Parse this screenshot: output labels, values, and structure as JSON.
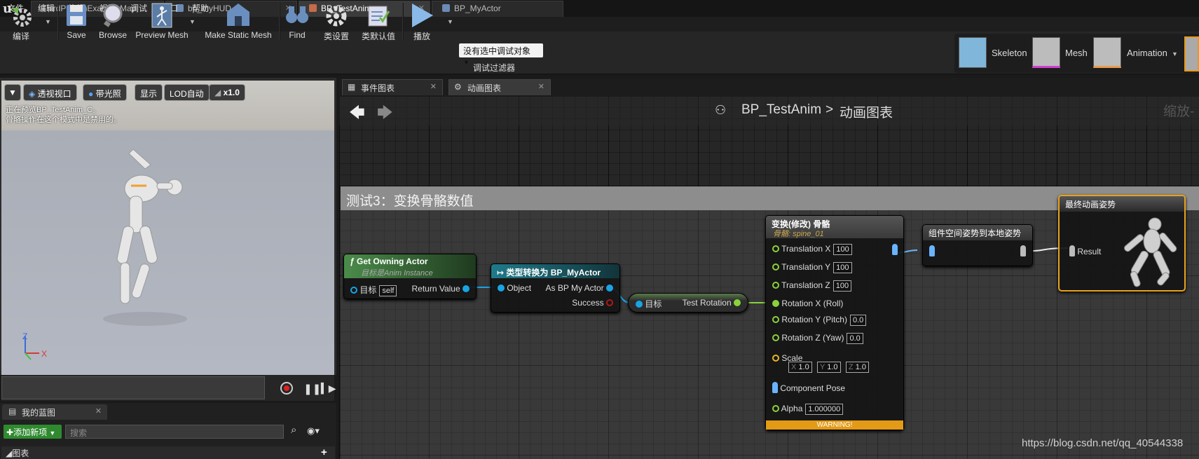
{
  "document_tabs": [
    {
      "label": "ThirdPersonExampleMap",
      "close": "✕"
    },
    {
      "label": "bp_myHUD",
      "close": "✕"
    },
    {
      "label": "BP_TestAnim",
      "close": "✕"
    },
    {
      "label": "BP_MyActor",
      "close": "✕"
    }
  ],
  "menu": [
    "文件",
    "编辑",
    "资源",
    "视图",
    "调试",
    "窗口",
    "帮助"
  ],
  "toolbar": {
    "compile": "编译",
    "save": "Save",
    "browse": "Browse",
    "preview_mesh": "Preview Mesh",
    "make_static_mesh": "Make Static Mesh",
    "find": "Find",
    "class_settings": "类设置",
    "class_defaults": "类默认值",
    "play": "播放",
    "debug_object": "没有选中调试对象",
    "debug_filter": "调试过滤器"
  },
  "modes": [
    "Skeleton",
    "Mesh",
    "Animation"
  ],
  "viewport": {
    "view_mode": "透视视口",
    "lit": "带光照",
    "show": "显示",
    "lod": "LOD自动",
    "speed": "x1.0",
    "info_line1": "正在预览BP_TestAnim_C。",
    "info_line2": "骨骼操作在这个模式中是禁用的。",
    "axis_z": "Z",
    "axis_x": "X"
  },
  "my_blueprint": {
    "tab_label": "我的蓝图",
    "add_new": "添加新项",
    "search_placeholder": "搜索",
    "graphs_header": "图表"
  },
  "graph_tabs": [
    "事件图表",
    "动画图表"
  ],
  "breadcrumb": {
    "asset": "BP_TestAnim",
    "separator": ">",
    "graph": "动画图表"
  },
  "zoom_label": "缩放-",
  "comment_title": "测试3：变换骨骼数值",
  "nodes": {
    "get_owning_actor": {
      "title": "Get Owning Actor",
      "subtitle": "目标是Anim Instance",
      "target_label": "目标",
      "target_value": "self",
      "return_label": "Return Value"
    },
    "cast": {
      "title": "类型转换为 BP_MyActor",
      "object_label": "Object",
      "as_label": "As BP My Actor",
      "success_label": "Success"
    },
    "test_rotation": {
      "target_label": "目标",
      "output_label": "Test Rotation"
    },
    "transform_bone": {
      "title": "变换(修改) 骨骼",
      "subtitle": "骨骼: spine_01",
      "translation_x": "Translation X",
      "translation_x_val": "100",
      "translation_y": "Translation Y",
      "translation_y_val": "100",
      "translation_z": "Translation Z",
      "translation_z_val": "100",
      "rotation_x": "Rotation X (Roll)",
      "rotation_y": "Rotation Y (Pitch)",
      "rotation_y_val": "0.0",
      "rotation_z": "Rotation Z (Yaw)",
      "rotation_z_val": "0.0",
      "scale": "Scale",
      "scale_x_lbl": "X",
      "scale_x": "1.0",
      "scale_y_lbl": "Y",
      "scale_y": "1.0",
      "scale_z_lbl": "Z",
      "scale_z": "1.0",
      "component_pose": "Component Pose",
      "alpha": "Alpha",
      "alpha_val": "1.000000",
      "warning": "WARNING!"
    },
    "component_to_local": {
      "title": "组件空间姿势到本地姿势"
    },
    "final_pose": {
      "title": "最终动画姿势",
      "result": "Result"
    }
  },
  "watermark": "https://blog.csdn.net/qq_40544338"
}
